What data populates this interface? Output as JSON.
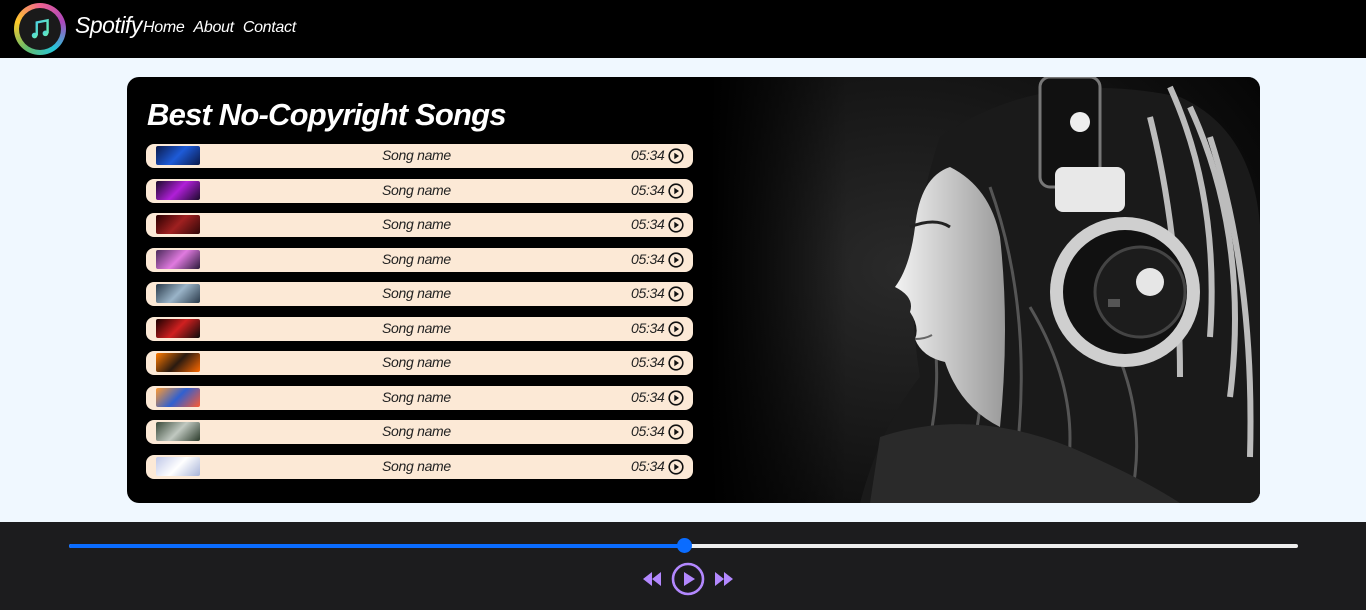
{
  "nav": {
    "brand": "Spotify",
    "links": [
      "Home",
      "About",
      "Contact"
    ]
  },
  "main": {
    "title": "Best No-Copyright Songs",
    "songs": [
      {
        "name": "Song name",
        "duration": "05:34"
      },
      {
        "name": "Song name",
        "duration": "05:34"
      },
      {
        "name": "Song name",
        "duration": "05:34"
      },
      {
        "name": "Song name",
        "duration": "05:34"
      },
      {
        "name": "Song name",
        "duration": "05:34"
      },
      {
        "name": "Song name",
        "duration": "05:34"
      },
      {
        "name": "Song name",
        "duration": "05:34"
      },
      {
        "name": "Song name",
        "duration": "05:34"
      },
      {
        "name": "Song name",
        "duration": "05:34"
      },
      {
        "name": "Song name",
        "duration": "05:34"
      }
    ]
  },
  "player": {
    "progress_fraction": 0.5,
    "accent_color": "#0a6cff",
    "control_color": "#b388ff"
  },
  "icons": {
    "logo": "music-note-icon",
    "song_play": "play-circle-icon",
    "prev": "backward-icon",
    "play": "play-circle-icon",
    "next": "forward-icon"
  }
}
